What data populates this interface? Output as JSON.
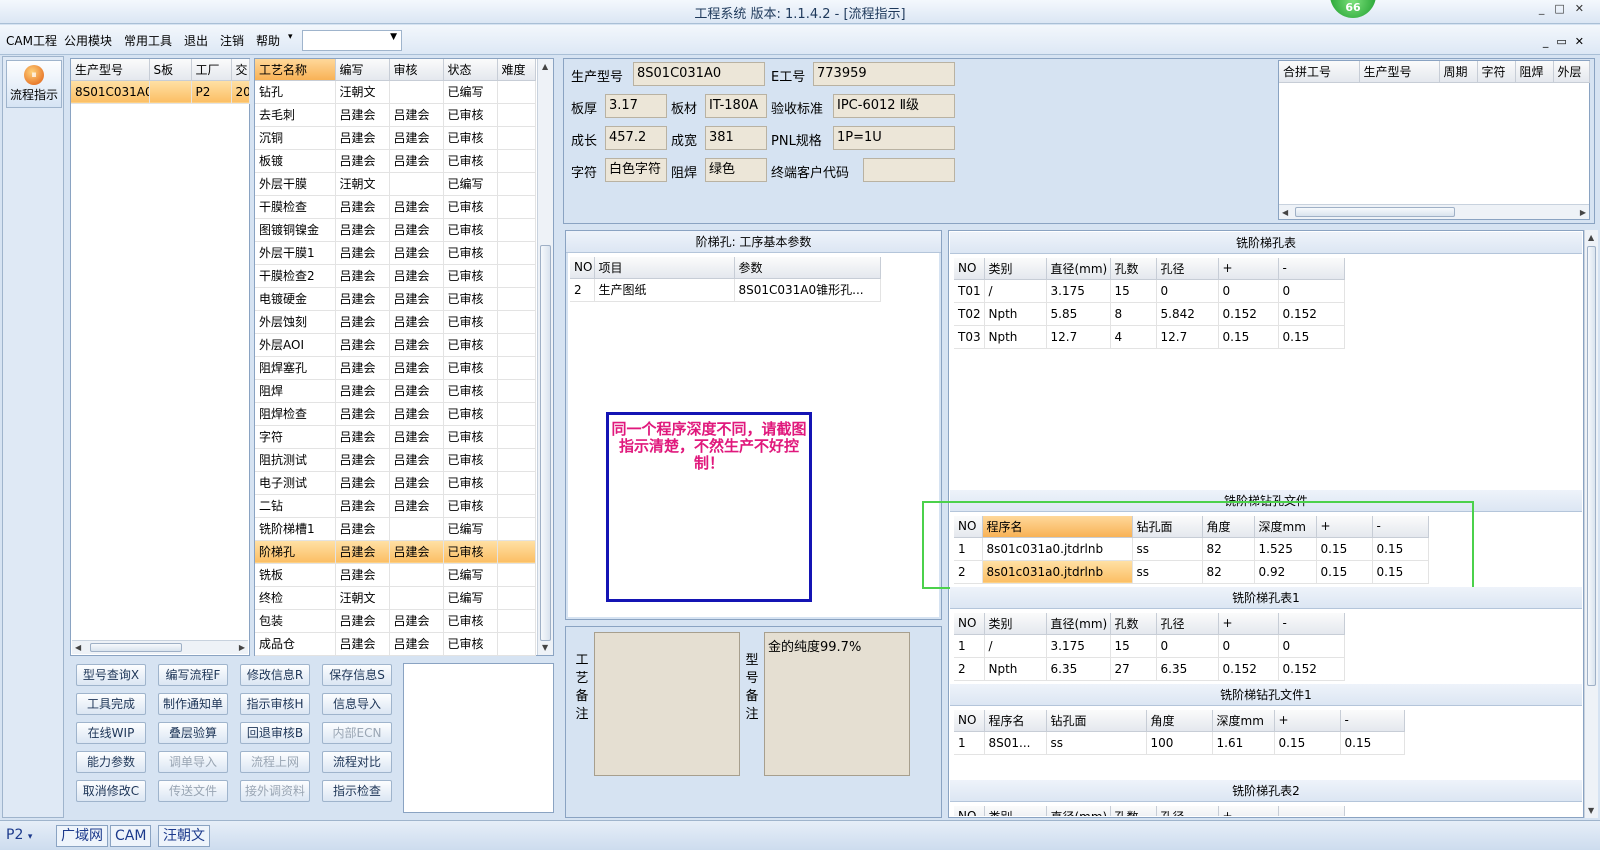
{
  "window": {
    "title": "工程系统  版本: 1.1.4.2 - [流程指示]",
    "badge": "66"
  },
  "menu": [
    "CAM工程",
    "公用模块",
    "常用工具",
    "退出",
    "注销",
    "帮助"
  ],
  "flow_button": "流程指示",
  "jobs": {
    "headers": [
      "生产型号",
      "S板",
      "工厂",
      "交"
    ],
    "rows": [
      [
        "8S01C031A0",
        "",
        "P2",
        "20"
      ]
    ]
  },
  "process": {
    "headers": [
      "工艺名称",
      "编写",
      "审核",
      "状态",
      "难度"
    ],
    "rows": [
      [
        "钻孔",
        "汪朝文",
        "",
        "已编写",
        ""
      ],
      [
        "去毛刺",
        "吕建会",
        "吕建会",
        "已审核",
        ""
      ],
      [
        "沉铜",
        "吕建会",
        "吕建会",
        "已审核",
        ""
      ],
      [
        "板镀",
        "吕建会",
        "吕建会",
        "已审核",
        ""
      ],
      [
        "外层干膜",
        "汪朝文",
        "",
        "已编写",
        ""
      ],
      [
        "干膜检查",
        "吕建会",
        "吕建会",
        "已审核",
        ""
      ],
      [
        "图镀铜镍金",
        "吕建会",
        "吕建会",
        "已审核",
        ""
      ],
      [
        "外层干膜1",
        "吕建会",
        "吕建会",
        "已审核",
        ""
      ],
      [
        "干膜检查2",
        "吕建会",
        "吕建会",
        "已审核",
        ""
      ],
      [
        "电镀硬金",
        "吕建会",
        "吕建会",
        "已审核",
        ""
      ],
      [
        "外层蚀刻",
        "吕建会",
        "吕建会",
        "已审核",
        ""
      ],
      [
        "外层AOI",
        "吕建会",
        "吕建会",
        "已审核",
        ""
      ],
      [
        "阻焊塞孔",
        "吕建会",
        "吕建会",
        "已审核",
        ""
      ],
      [
        "阻焊",
        "吕建会",
        "吕建会",
        "已审核",
        ""
      ],
      [
        "阻焊检查",
        "吕建会",
        "吕建会",
        "已审核",
        ""
      ],
      [
        "字符",
        "吕建会",
        "吕建会",
        "已审核",
        ""
      ],
      [
        "阻抗测试",
        "吕建会",
        "吕建会",
        "已审核",
        ""
      ],
      [
        "电子测试",
        "吕建会",
        "吕建会",
        "已审核",
        ""
      ],
      [
        "二钻",
        "吕建会",
        "吕建会",
        "已审核",
        ""
      ],
      [
        "铣阶梯槽1",
        "吕建会",
        "",
        "已编写",
        ""
      ],
      [
        "阶梯孔",
        "吕建会",
        "吕建会",
        "已审核",
        ""
      ],
      [
        "铣板",
        "吕建会",
        "",
        "已编写",
        ""
      ],
      [
        "终检",
        "汪朝文",
        "",
        "已编写",
        ""
      ],
      [
        "包装",
        "吕建会",
        "吕建会",
        "已审核",
        ""
      ],
      [
        "成品仓",
        "吕建会",
        "吕建会",
        "已审核",
        ""
      ]
    ],
    "selected_index": 20
  },
  "buttons": [
    [
      "型号查询X",
      "编写流程F",
      "修改信息R",
      "保存信息S"
    ],
    [
      "工具完成",
      "制作通知单",
      "指示审核H",
      "信息导入"
    ],
    [
      "在线WIP",
      "叠层验算",
      "回退审核B",
      "内部ECN"
    ],
    [
      "能力参数",
      "调单导入",
      "流程上网",
      "流程对比"
    ],
    [
      "取消修改C",
      "传送文件",
      "接外调资料",
      "指示检查"
    ]
  ],
  "buttons_disabled": [
    "内部ECN",
    "调单导入",
    "流程上网",
    "传送文件",
    "接外调资料"
  ],
  "info": {
    "model_label": "生产型号",
    "model": "8S01C031A0",
    "e_label": "E工号",
    "e": "773959",
    "thick_label": "板厚",
    "thick": "3.17",
    "mat_label": "板材",
    "mat": "IT-180A",
    "std_label": "验收标准",
    "std": "IPC-6012 Ⅱ级",
    "len_label": "成长",
    "len": "457.2",
    "wid_label": "成宽",
    "wid": "381",
    "pnl_label": "PNL规格",
    "pnl": "1P=1U",
    "char_label": "字符",
    "char": "白色字符",
    "mask_label": "阻焊",
    "mask": "绿色",
    "cust_label": "终端客户代码",
    "cust": ""
  },
  "merge": {
    "headers": [
      "合拼工号",
      "生产型号",
      "周期",
      "字符",
      "阻焊",
      "外层"
    ]
  },
  "step_params": {
    "title": "阶梯孔: 工序基本参数",
    "headers": [
      "NO",
      "项目",
      "参数"
    ],
    "rows": [
      [
        "2",
        "生产图纸",
        "8S01C031A0锥形孔..."
      ]
    ]
  },
  "note": "同一个程序深度不同，请截图指示清楚，不然生产不好控制！",
  "craft_note_label": "工艺备注",
  "model_note_label": "型号备注",
  "model_note": "金的纯度99.7%",
  "table1": {
    "title": "铣阶梯孔表",
    "headers": [
      "NO",
      "类别",
      "直径(mm)",
      "孔数",
      "孔径",
      "+",
      "-"
    ],
    "rows": [
      [
        "T01",
        "/",
        "3.175",
        "15",
        "0",
        "0",
        "0"
      ],
      [
        "T02",
        "Npth",
        "5.85",
        "8",
        "5.842",
        "0.152",
        "0.152"
      ],
      [
        "T03",
        "Npth",
        "12.7",
        "4",
        "12.7",
        "0.15",
        "0.15"
      ]
    ]
  },
  "table2": {
    "title": "铣阶梯钻孔文件",
    "headers": [
      "NO",
      "程序名",
      "钻孔面",
      "角度",
      "深度mm",
      "+",
      "-"
    ],
    "rows": [
      [
        "1",
        "8s01c031a0.jtdrlnb",
        "ss",
        "82",
        "1.525",
        "0.15",
        "0.15"
      ],
      [
        "2",
        "8s01c031a0.jtdrlnb",
        "ss",
        "82",
        "0.92",
        "0.15",
        "0.15"
      ]
    ]
  },
  "table3": {
    "title": "铣阶梯孔表1",
    "headers": [
      "NO",
      "类别",
      "直径(mm)",
      "孔数",
      "孔径",
      "+",
      "-"
    ],
    "rows": [
      [
        "1",
        "/",
        "3.175",
        "15",
        "0",
        "0",
        "0"
      ],
      [
        "2",
        "Npth",
        "6.35",
        "27",
        "6.35",
        "0.152",
        "0.152"
      ]
    ]
  },
  "table4": {
    "title": "铣阶梯钻孔文件1",
    "headers": [
      "NO",
      "程序名",
      "钻孔面",
      "角度",
      "深度mm",
      "+",
      "-"
    ],
    "rows": [
      [
        "1",
        "8S01...",
        "ss",
        "100",
        "1.61",
        "0.15",
        "0.15"
      ]
    ]
  },
  "table5": {
    "title": "铣阶梯孔表2",
    "headers": [
      "NO",
      "类别",
      "直径(mm)",
      "孔数",
      "孔径",
      "+",
      "-"
    ]
  },
  "status": {
    "factory": "P2",
    "network": "广域网",
    "dept": "CAM",
    "user": "汪朝文"
  }
}
